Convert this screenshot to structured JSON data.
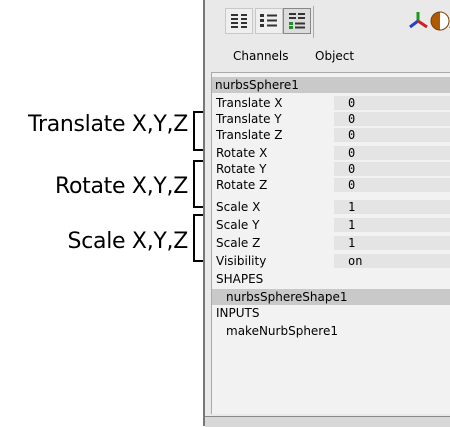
{
  "callouts": {
    "translate": "Translate X,Y,Z",
    "rotate": "Rotate X,Y,Z",
    "scale": "Scale X,Y,Z"
  },
  "toolbar": {
    "buttons": [
      {
        "icon": "channel-box-icon"
      },
      {
        "icon": "layer-editor-icon"
      },
      {
        "icon": "channel-layer-icon"
      }
    ],
    "right_icons": [
      "create-icon",
      "render-icon",
      "arrow-icon"
    ]
  },
  "tabs": {
    "channels": "Channels",
    "object": "Object"
  },
  "object_name": "nurbsSphere1",
  "channels": [
    {
      "label": "Translate X",
      "value": "0"
    },
    {
      "label": "Translate Y",
      "value": "0"
    },
    {
      "label": "Translate Z",
      "value": "0"
    },
    {
      "label": "Rotate X",
      "value": "0"
    },
    {
      "label": "Rotate Y",
      "value": "0"
    },
    {
      "label": "Rotate Z",
      "value": "0"
    },
    {
      "label": "Scale X",
      "value": "1"
    },
    {
      "label": "Scale Y",
      "value": "1"
    },
    {
      "label": "Scale Z",
      "value": "1"
    },
    {
      "label": "Visibility",
      "value": "on"
    }
  ],
  "shapes": {
    "header": "SHAPES",
    "item": "nurbsSphereShape1"
  },
  "inputs": {
    "header": "INPUTS",
    "item": "makeNurbSphere1"
  }
}
